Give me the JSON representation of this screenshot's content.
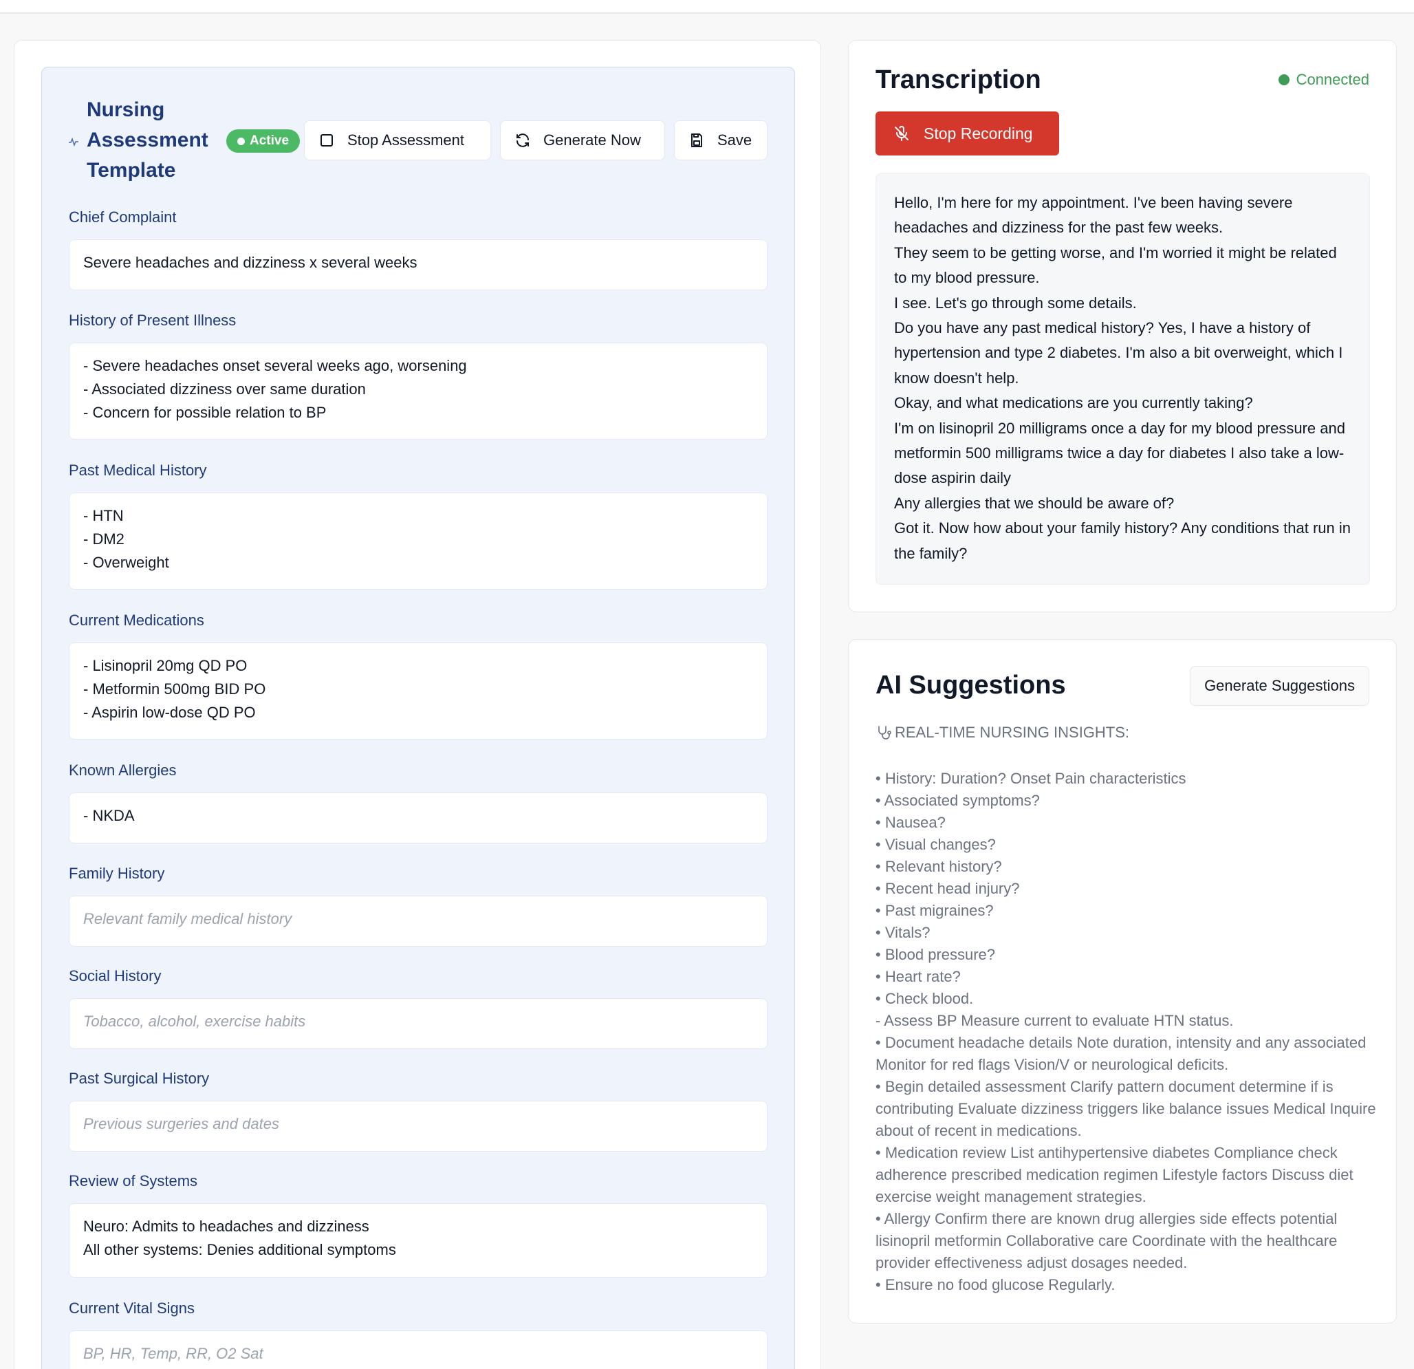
{
  "form": {
    "title": "Nursing Assessment Template",
    "status_badge": "Active",
    "buttons": {
      "stop_assessment": "Stop Assessment",
      "generate_now": "Generate Now",
      "save": "Save"
    },
    "sections": [
      {
        "label": "Chief Complaint",
        "value": "Severe headaches and dizziness x several weeks",
        "placeholder": ""
      },
      {
        "label": "History of Present Illness",
        "value": "- Severe headaches onset several weeks ago, worsening\n- Associated dizziness over same duration\n- Concern for possible relation to BP",
        "placeholder": ""
      },
      {
        "label": "Past Medical History",
        "value": "- HTN\n- DM2\n- Overweight",
        "placeholder": ""
      },
      {
        "label": "Current Medications",
        "value": "- Lisinopril 20mg QD PO\n- Metformin 500mg BID PO\n- Aspirin low-dose QD PO",
        "placeholder": ""
      },
      {
        "label": "Known Allergies",
        "value": "- NKDA",
        "placeholder": ""
      },
      {
        "label": "Family History",
        "value": "",
        "placeholder": "Relevant family medical history"
      },
      {
        "label": "Social History",
        "value": "",
        "placeholder": "Tobacco, alcohol, exercise habits"
      },
      {
        "label": "Past Surgical History",
        "value": "",
        "placeholder": "Previous surgeries and dates"
      },
      {
        "label": "Review of Systems",
        "value": "Neuro: Admits to headaches and dizziness\nAll other systems: Denies additional symptoms",
        "placeholder": ""
      },
      {
        "label": "Current Vital Signs",
        "value": "",
        "placeholder": "BP, HR, Temp, RR, O2 Sat"
      }
    ]
  },
  "transcription": {
    "title": "Transcription",
    "status": "Connected",
    "stop_recording_label": "Stop Recording",
    "lines": [
      "Hello, I'm here for my appointment. I've been having severe headaches and dizziness for the past few weeks.",
      "They seem to be getting worse, and I'm worried it might be related to my blood pressure.",
      "I see. Let's go through some details.",
      "Do you have any past medical history? Yes, I have a history of hypertension and type 2 diabetes. I'm also a bit overweight, which I know doesn't help.",
      "Okay, and what medications are you currently taking?",
      "I'm on lisinopril 20 milligrams once a day for my blood pressure and metformin 500 milligrams twice a day for diabetes I also take a low-dose aspirin daily",
      "Any allergies that we should be aware of?",
      "Got it. Now how about your family history? Any conditions that run in the family?"
    ]
  },
  "ai_suggestions": {
    "title": "AI Suggestions",
    "generate_label": "Generate Suggestions",
    "heading": "REAL-TIME NURSING INSIGHTS:",
    "items": [
      "• History: Duration? Onset Pain characteristics",
      "• Associated symptoms?",
      "• Nausea?",
      "• Visual changes?",
      "• Relevant history?",
      "• Recent head injury?",
      "• Past migraines?",
      "• Vitals?",
      "• Blood pressure?",
      "• Heart rate?",
      "• Check blood.",
      "- Assess BP Measure current to evaluate HTN status.",
      "• Document headache details Note duration, intensity and any associated Monitor for red flags Vision/V or neurological deficits.",
      "• Begin detailed assessment Clarify pattern document determine if is contributing Evaluate dizziness triggers like balance issues Medical Inquire about of recent in medications.",
      "• Medication review List antihypertensive diabetes Compliance check adherence prescribed medication regimen Lifestyle factors Discuss diet exercise weight management strategies.",
      "• Allergy Confirm there are known drug allergies side effects potential lisinopril metformin Collaborative care Coordinate with the healthcare provider effectiveness adjust dosages needed.",
      "• Ensure no food glucose Regularly."
    ]
  },
  "colors": {
    "accent_blue": "#1f3a7a",
    "active_green": "#4cb965",
    "connected_green": "#3f9b55",
    "stop_red": "#d4372c"
  },
  "icons": {
    "form_title": "pulse-icon",
    "stop_assessment": "square-icon",
    "generate_now": "refresh-icon",
    "save": "save-icon",
    "stop_recording": "mic-off-icon",
    "insights": "stethoscope-icon"
  }
}
